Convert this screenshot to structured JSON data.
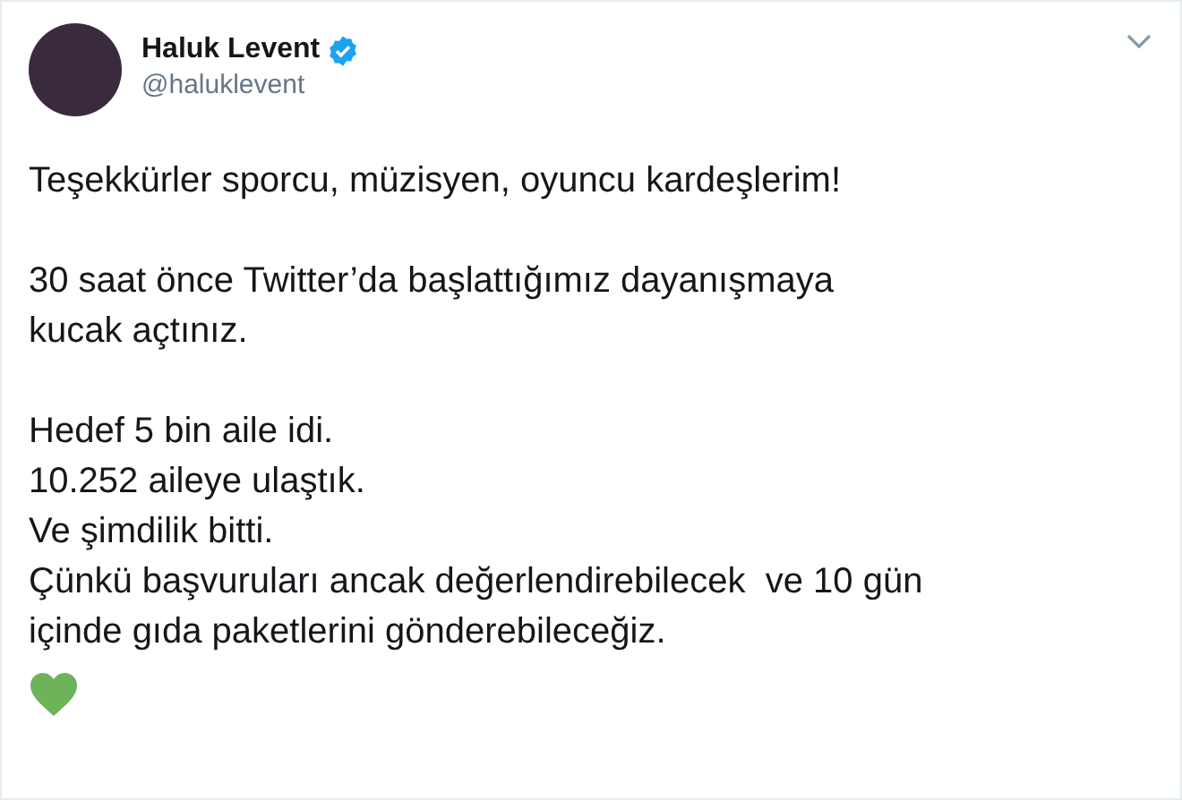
{
  "author": {
    "name": "Haluk Levent",
    "verified": true,
    "handle": "@haluklevent"
  },
  "paragraphs": [
    {
      "lines": [
        "Teşekkürler sporcu, müzisyen, oyuncu kardeşlerim!"
      ]
    },
    {
      "lines": [
        "30 saat önce Twitter’da başlattığımız dayanışmaya",
        "kucak açtınız."
      ]
    },
    {
      "lines": [
        "Hedef 5 bin aile idi.",
        "10.252 aileye ulaştık.",
        "Ve şimdilik bitti.",
        "Çünkü başvuruları ancak değerlendirebilecek  ve 10 gün",
        "içinde gıda paketlerini gönderebileceğiz."
      ]
    }
  ]
}
